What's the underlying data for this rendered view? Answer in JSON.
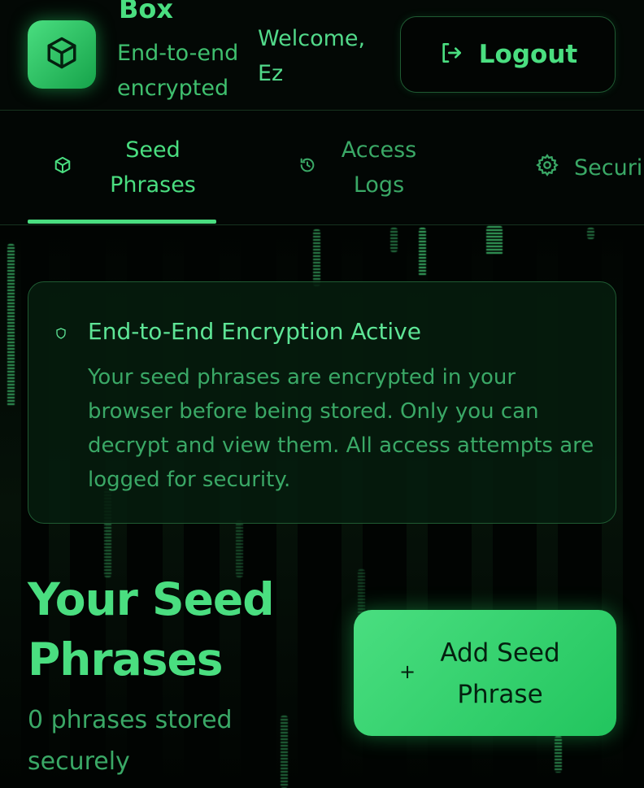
{
  "header": {
    "brand_name": "Box",
    "brand_subtitle": "End-to-end encrypted",
    "welcome_text": "Welcome, Ez",
    "logout_label": "Logout",
    "logo_icon": "cube-icon",
    "logout_icon": "sign-out-icon"
  },
  "tabs": [
    {
      "label": "Seed Phrases",
      "icon": "cube-icon",
      "active": true
    },
    {
      "label": "Access Logs",
      "icon": "history-icon",
      "active": false
    },
    {
      "label": "Securi",
      "icon": "gear-icon",
      "active": false
    }
  ],
  "info_card": {
    "icon": "shield-icon",
    "title": "End-to-End Encryption Active",
    "body": "Your seed phrases are encrypted in your browser before being stored. Only you can decrypt and view them. All access attempts are logged for security."
  },
  "section": {
    "title": "Your Seed Phrases",
    "subtitle": "0 phrases stored securely",
    "add_button_label": "Add Seed Phrase",
    "add_icon": "plus-icon"
  },
  "colors": {
    "accent": "#4ade80",
    "accent_dark": "#22c55e",
    "background": "#010402",
    "muted_text": "#3aa866",
    "border": "#1f5a32"
  }
}
